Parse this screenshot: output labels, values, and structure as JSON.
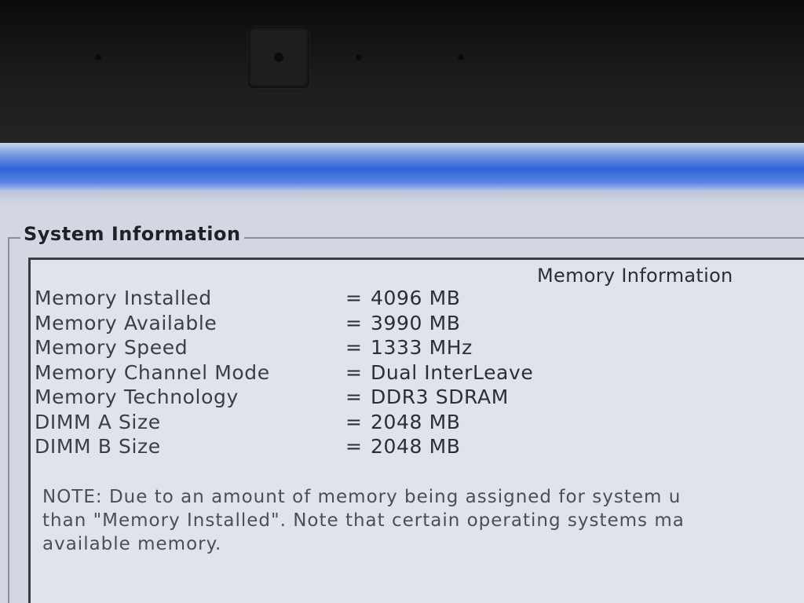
{
  "group_title": "System Information",
  "section_header": "Memory Information",
  "rows": [
    {
      "label": "Memory Installed",
      "eq": "=",
      "value": "4096 MB"
    },
    {
      "label": "Memory Available",
      "eq": "=",
      "value": "3990 MB"
    },
    {
      "label": "Memory Speed",
      "eq": "=",
      "value": "1333 MHz"
    },
    {
      "label": "Memory Channel Mode",
      "eq": "=",
      "value": "Dual InterLeave"
    },
    {
      "label": "Memory Technology",
      "eq": "=",
      "value": "DDR3 SDRAM"
    },
    {
      "label": "DIMM A Size",
      "eq": "=",
      "value": "2048 MB"
    },
    {
      "label": "DIMM B Size",
      "eq": "=",
      "value": "2048 MB"
    }
  ],
  "note_lines": [
    "NOTE: Due to an amount of memory being assigned for system u",
    "than \"Memory Installed\". Note that certain operating systems ma",
    "available memory."
  ],
  "colors": {
    "title_bar_blue": "#2f63d8",
    "background": "#d4d7e1",
    "text": "#2b2e3a"
  }
}
